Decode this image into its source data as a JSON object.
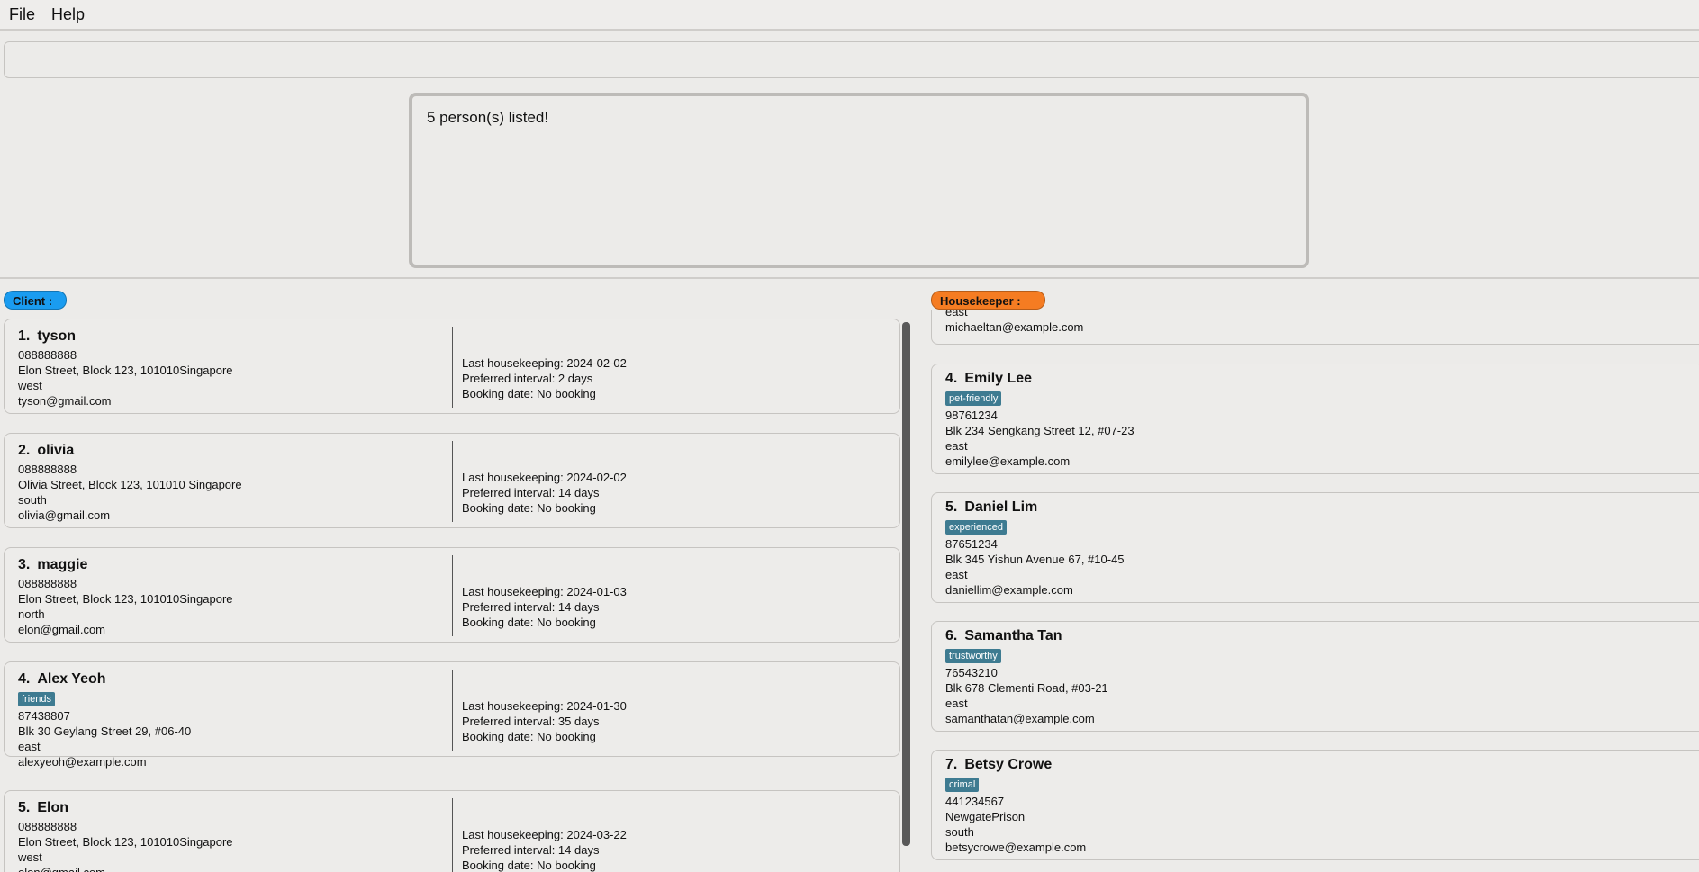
{
  "menu": {
    "file": "File",
    "help": "Help"
  },
  "command": {
    "value": "",
    "placeholder": ""
  },
  "result": {
    "message": "5 person(s) listed!"
  },
  "client_panel": {
    "title": "Client :",
    "clients": [
      {
        "index": "1.",
        "name": "tyson",
        "tags": [],
        "phone": "088888888",
        "address": "Elon Street, Block 123, 101010Singapore",
        "region": "west",
        "email": "tyson@gmail.com",
        "last": "Last housekeeping: 2024-02-02",
        "interval": "Preferred interval: 2 days",
        "booking": "Booking date: No booking"
      },
      {
        "index": "2.",
        "name": "olivia",
        "tags": [],
        "phone": "088888888",
        "address": "Olivia Street, Block 123, 101010 Singapore",
        "region": "south",
        "email": "olivia@gmail.com",
        "last": "Last housekeeping: 2024-02-02",
        "interval": "Preferred interval: 14 days",
        "booking": "Booking date: No booking"
      },
      {
        "index": "3.",
        "name": "maggie",
        "tags": [],
        "phone": "088888888",
        "address": "Elon Street, Block 123, 101010Singapore",
        "region": "north",
        "email": "elon@gmail.com",
        "last": "Last housekeeping: 2024-01-03",
        "interval": "Preferred interval: 14 days",
        "booking": "Booking date: No booking"
      },
      {
        "index": "4.",
        "name": "Alex Yeoh",
        "tags": [
          "friends"
        ],
        "phone": "87438807",
        "address": "Blk 30 Geylang Street 29, #06-40",
        "region": "east",
        "email": "alexyeoh@example.com",
        "last": "Last housekeeping: 2024-01-30",
        "interval": "Preferred interval: 35 days",
        "booking": "Booking date: No booking"
      },
      {
        "index": "5.",
        "name": "Elon",
        "tags": [],
        "phone": "088888888",
        "address": "Elon Street, Block 123, 101010Singapore",
        "region": "west",
        "email": "elon@gmail.com",
        "last": "Last housekeeping: 2024-03-22",
        "interval": "Preferred interval: 14 days",
        "booking": "Booking date: No booking"
      }
    ]
  },
  "housekeeper_panel": {
    "title": "Housekeeper :",
    "partial": {
      "region": "east",
      "email": "michaeltan@example.com"
    },
    "housekeepers": [
      {
        "index": "4.",
        "name": "Emily Lee",
        "tag": "pet-friendly",
        "phone": "98761234",
        "address": "Blk 234 Sengkang Street 12, #07-23",
        "region": "east",
        "email": "emilylee@example.com"
      },
      {
        "index": "5.",
        "name": "Daniel Lim",
        "tag": "experienced",
        "phone": "87651234",
        "address": "Blk 345 Yishun Avenue 67, #10-45",
        "region": "east",
        "email": "daniellim@example.com"
      },
      {
        "index": "6.",
        "name": "Samantha Tan",
        "tag": "trustworthy",
        "phone": "76543210",
        "address": "Blk 678 Clementi Road, #03-21",
        "region": "east",
        "email": "samanthatan@example.com"
      },
      {
        "index": "7.",
        "name": "Betsy Crowe",
        "tag": "crimal",
        "phone": "441234567",
        "address": "NewgatePrison",
        "region": "south",
        "email": "betsycrowe@example.com"
      }
    ]
  },
  "colors": {
    "client_accent": "#1a9cf0",
    "housekeeper_accent": "#f57c22",
    "tag_bg": "#3e7b91"
  }
}
